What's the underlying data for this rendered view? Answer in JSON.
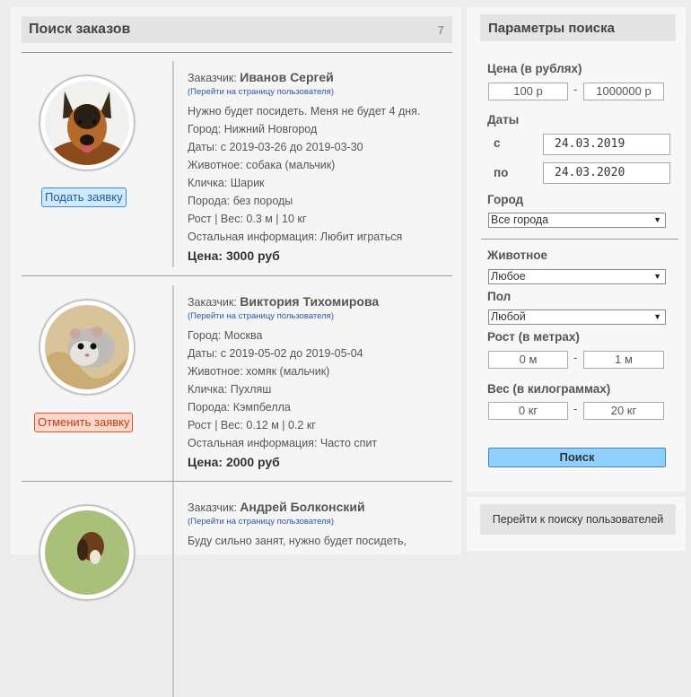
{
  "search": {
    "title": "Поиск заказов",
    "count": "7"
  },
  "orders": [
    {
      "customer_label": "Заказчик:",
      "customer": "Иванов Сергей",
      "profile_link": "(Перейти на страницу пользователя)",
      "note": "Нужно будет посидеть. Меня не будет 4 дня.",
      "city": "Город: Нижний Новгород",
      "dates": "Даты: с 2019-03-26 до 2019-03-30",
      "animal": "Животное: собака (мальчик)",
      "name": "Кличка: Шарик",
      "breed": "Порода: без породы",
      "size": "Рост | Вес: 0.3 м | 10 кг",
      "other": "Остальная информация: Любит играться",
      "price": "Цена: 3000 руб",
      "action": "Подать заявку"
    },
    {
      "customer_label": "Заказчик:",
      "customer": "Виктория Тихомирова",
      "profile_link": "(Перейти на страницу пользователя)",
      "city": "Город: Москва",
      "dates": "Даты: с 2019-05-02 до 2019-05-04",
      "animal": "Животное: хомяк (мальчик)",
      "name": "Кличка: Пухляш",
      "breed": "Порода: Кэмпбелла",
      "size": "Рост | Вес: 0.12 м | 0.2 кг",
      "other": "Остальная информация: Часто спит",
      "price": "Цена: 2000 руб",
      "action": "Отменить заявку"
    },
    {
      "customer_label": "Заказчик:",
      "customer": "Андрей Болконский",
      "profile_link": "(Перейти на страницу пользователя)",
      "note": "Буду сильно занят, нужно будет посидеть,"
    }
  ],
  "params": {
    "title": "Параметры поиска",
    "price_label": "Цена (в рублях)",
    "price_from": "100 р",
    "price_to": "1000000 р",
    "dates_label": "Даты",
    "from_label": "с",
    "from_value": "24.03.2019",
    "to_label": "по",
    "to_value": "24.03.2020",
    "city_label": "Город",
    "city_value": "Все города",
    "animal_label": "Животное",
    "animal_value": "Любое",
    "sex_label": "Пол",
    "sex_value": "Любой",
    "height_label": "Рост (в метрах)",
    "height_from": "0 м",
    "height_to": "1 м",
    "weight_label": "Вес (в килограммах)",
    "weight_from": "0 кг",
    "weight_to": "20 кг",
    "search_button": "Поиск",
    "dash": "-"
  },
  "users_search": "Перейти к поиску пользователей"
}
